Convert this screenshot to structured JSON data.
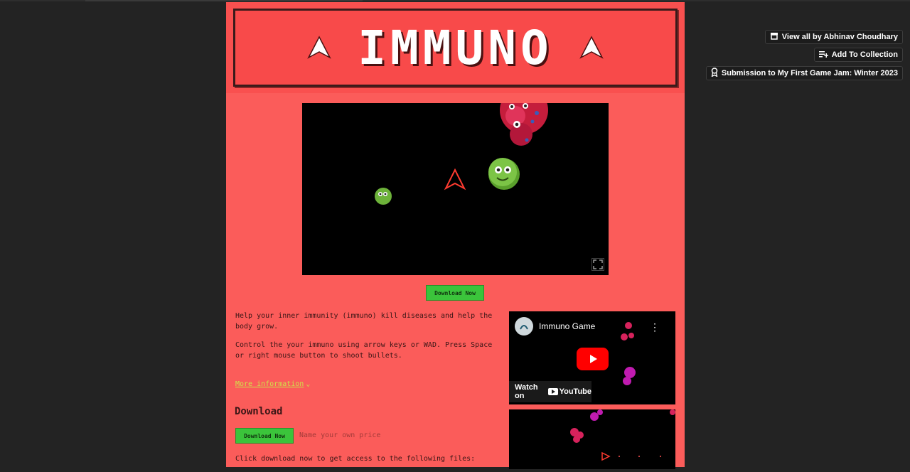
{
  "sidebar": {
    "view_all": "View all by Abhinav Choudhary",
    "add_collection": "Add To Collection",
    "submission": "Submission to My First Game Jam: Winter 2023"
  },
  "header": {
    "title": "IMMUNO"
  },
  "game": {
    "download_now": "Download Now"
  },
  "description": {
    "para1": "Help your inner immunity (immuno) kill diseases and help the body grow.",
    "para2": "Control the your immuno using arrow keys or WAD. Press Space or right mouse button to shoot bullets.",
    "more_info": "More information"
  },
  "download": {
    "heading": "Download",
    "button": "Download Now",
    "price_placeholder": "Name your own price",
    "files_text": "Click download now to get access to the following files:"
  },
  "video": {
    "title": "Immuno Game",
    "watch_on": "Watch on",
    "youtube": "YouTube"
  },
  "colors": {
    "page_bg": "#fb5c5a",
    "banner_bg": "#f84a4a",
    "button_green": "#3bc43b",
    "link": "#cfe34a"
  }
}
